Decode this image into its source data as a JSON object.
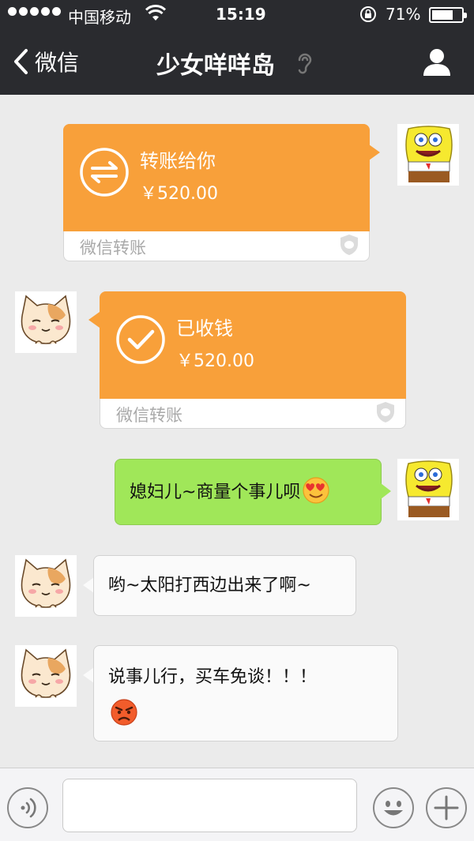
{
  "status_bar": {
    "carrier": "中国移动",
    "time": "15:19",
    "battery": "71%",
    "battery_level": 0.71
  },
  "nav": {
    "back_label": "微信",
    "title": "少女咩咩岛"
  },
  "messages": [
    {
      "type": "transfer",
      "direction": "sent",
      "title": "转账给你",
      "amount": "￥520.00",
      "footer": "微信转账",
      "icon": "transfer-arrows-icon"
    },
    {
      "type": "transfer",
      "direction": "received",
      "title": "已收钱",
      "amount": "￥520.00",
      "footer": "微信转账",
      "icon": "checkmark-icon"
    },
    {
      "type": "text",
      "direction": "sent",
      "text": "媳妇儿~商量个事儿呗",
      "emoji": "heart-eyes-emoji"
    },
    {
      "type": "text",
      "direction": "received",
      "text": "哟~太阳打西边出来了啊~"
    },
    {
      "type": "text",
      "direction": "received",
      "text": "说事儿行，买车免谈！！！",
      "emoji": "angry-face-emoji"
    }
  ],
  "input_bar": {
    "value": "",
    "placeholder": ""
  },
  "colors": {
    "nav_bg": "#2a2b2f",
    "chat_bg": "#ebebeb",
    "transfer_orange": "#f8a03a",
    "sent_bubble": "#a0e759",
    "received_bubble": "#fafafa"
  }
}
